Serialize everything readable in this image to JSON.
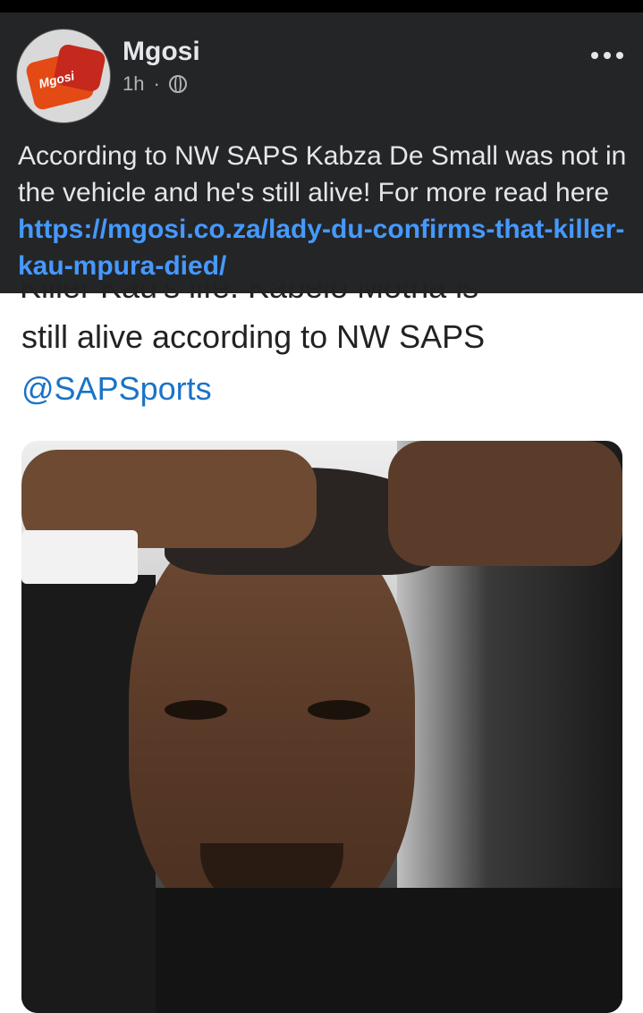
{
  "post": {
    "author": "Mgosi",
    "time": "1h",
    "dot": "·",
    "avatar_text": "Mgosi",
    "text": "According to NW SAPS Kabza De Small was not in the vehicle and he's still alive! For more read here ",
    "link": "https://mgosi.co.za/lady-du-confirms-that-killer-kau-mpura-died/"
  },
  "tweet": {
    "cut_line": "Killer Kau's life. Kabelo Motha is",
    "line": "still alive according to NW SAPS",
    "handle": "@SAPSports"
  },
  "icons": {
    "more": "more-options-icon",
    "globe": "globe-icon"
  }
}
